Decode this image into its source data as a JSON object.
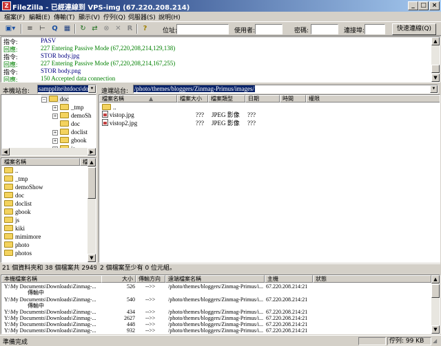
{
  "window": {
    "title": "FileZilla - 已經連線到 VPS-img (67.220.208.214)",
    "app_icon": "filezilla-icon",
    "title_color": "#0a246a"
  },
  "menu": [
    "檔案(F)",
    "編輯(E)",
    "傳輸(T)",
    "顯示(V)",
    "佇列(Q)",
    "伺服器(S)",
    "說明(H)"
  ],
  "quickconnect": {
    "host_label": "位址:",
    "host_value": "",
    "user_label": "使用者:",
    "user_value": "",
    "pass_label": "密碼:",
    "pass_value": "",
    "port_label": "連接埠:",
    "port_value": "",
    "button": "快速連線(Q)"
  },
  "log": [
    {
      "kind": "指令:",
      "msg": "PASV",
      "color": "#000080"
    },
    {
      "kind": "回應:",
      "msg": "227 Entering Passive Mode (67,220,208,214,129,138)",
      "color": "#008000"
    },
    {
      "kind": "指令:",
      "msg": "STOR body.jpg",
      "color": "#000080"
    },
    {
      "kind": "回應:",
      "msg": "227 Entering Passive Mode (67,220,208,214,167,255)",
      "color": "#008000"
    },
    {
      "kind": "指令:",
      "msg": "STOR body.png",
      "color": "#000080"
    },
    {
      "kind": "回應:",
      "msg": "150 Accepted data connection",
      "color": "#008000"
    }
  ],
  "local": {
    "path_label": "本機站台:",
    "path_value": "sampplite\\htdocs\\doc\\",
    "tree": [
      "doc",
      "_tmp",
      "demoSh",
      "doc",
      "doclist",
      "gbook",
      "js"
    ],
    "headers": {
      "name": "檔案名稱",
      "size": "檔"
    },
    "files": [
      "..",
      "_tmp",
      "demoShow",
      "doc",
      "doclist",
      "gbook",
      "js",
      "kiki",
      "mimimore",
      "photo",
      "photos"
    ],
    "status": "21 個資料夾和 38 個檔案共 294966 位"
  },
  "remote": {
    "path_label": "遠端站台:",
    "path_value": "/photo/themes/bloggers/Zinmag-Primus/images/",
    "headers": {
      "name": "檔案名稱",
      "size": "檔案大小",
      "type": "檔案類型",
      "date": "日期",
      "time": "時間",
      "perm": "權限"
    },
    "files": [
      {
        "name": "..",
        "size": "",
        "type": "",
        "date": "",
        "is_folder": true
      },
      {
        "name": "vistop.jpg",
        "size": "???",
        "type": "JPEG 影像",
        "date": "???",
        "is_folder": false
      },
      {
        "name": "vistop2.jpg",
        "size": "???",
        "type": "JPEG 影像",
        "date": "???",
        "is_folder": false
      }
    ],
    "status": "2 個檔案至少有 0 位元組。"
  },
  "queue": {
    "headers": {
      "local": "本機檔案名稱",
      "size": "大小",
      "dir": "傳輸方向",
      "remote": "遠端檔案名稱",
      "host": "主機",
      "status": "狀態"
    },
    "rows": [
      {
        "local": "Y:\\My Documents\\Downloads\\Zinmag-...",
        "size": "526",
        "dir": "-->>",
        "remote": "/photo/themes/bloggers/Zinmag-Primus/i...",
        "host": "67.220.208.214:21",
        "note": "傳輸中"
      },
      {
        "local": "Y:\\My Documents\\Downloads\\Zinmag-...",
        "size": "540",
        "dir": "-->>",
        "remote": "/photo/themes/bloggers/Zinmag-Primus/i...",
        "host": "67.220.208.214:21",
        "note": "傳輸中"
      },
      {
        "local": "Y:\\My Documents\\Downloads\\Zinmag-...",
        "size": "434",
        "dir": "-->>",
        "remote": "/photo/themes/bloggers/Zinmag-Primus/i...",
        "host": "67.220.208.214:21",
        "note": ""
      },
      {
        "local": "Y:\\My Documents\\Downloads\\Zinmag-...",
        "size": "2627",
        "dir": "-->>",
        "remote": "/photo/themes/bloggers/Zinmag-Primus/i...",
        "host": "67.220.208.214:21",
        "note": ""
      },
      {
        "local": "Y:\\My Documents\\Downloads\\Zinmag-...",
        "size": "448",
        "dir": "-->>",
        "remote": "/photo/themes/bloggers/Zinmag-Primus/i...",
        "host": "67.220.208.214:21",
        "note": ""
      },
      {
        "local": "Y:\\My Documents\\Downloads\\Zinmag-...",
        "size": "932",
        "dir": "-->>",
        "remote": "/photo/themes/bloggers/Zinmag-Primus/i...",
        "host": "67.220.208.214:21",
        "note": ""
      }
    ]
  },
  "statusbar": {
    "left": "準備完成",
    "queue": "佇列: 99 KB"
  }
}
